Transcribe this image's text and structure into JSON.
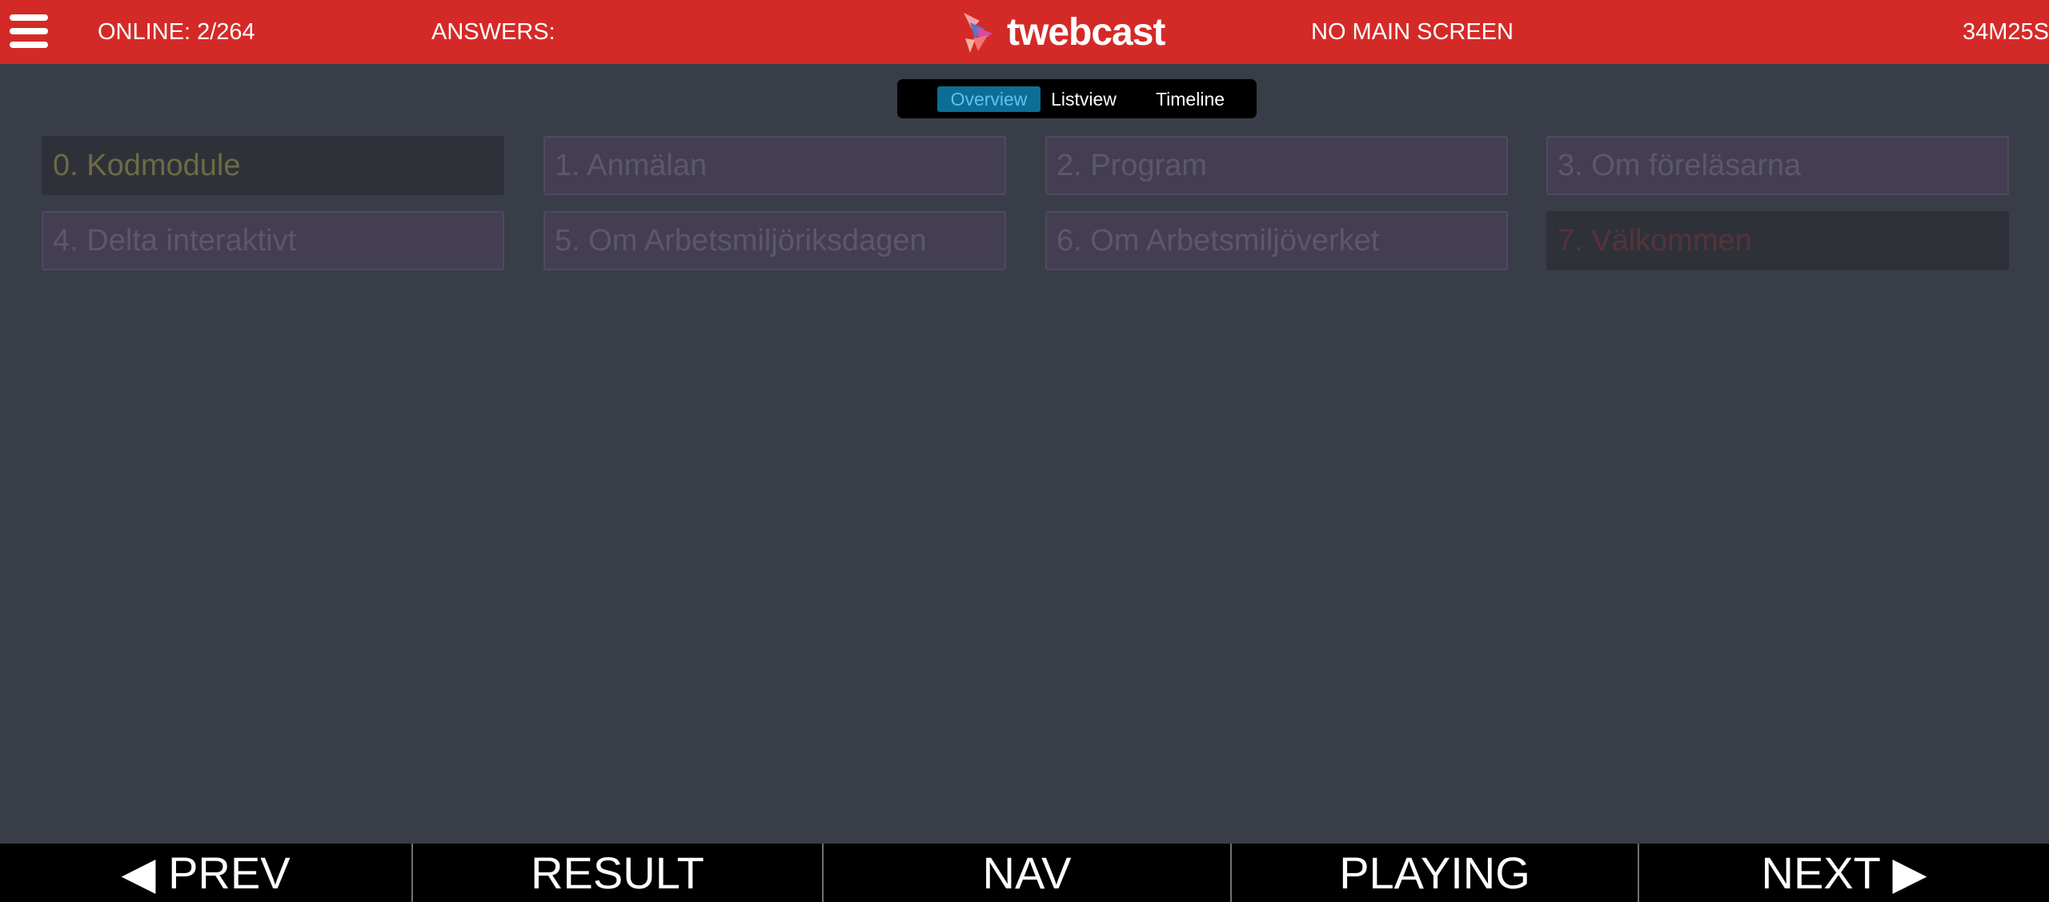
{
  "header": {
    "menu_icon": "hamburger-menu-icon",
    "online": "ONLINE: 2/264",
    "answers": "ANSWERS:",
    "logo_text": "twebcast",
    "main_screen": "NO MAIN SCREEN",
    "timer": "34M25S",
    "colors": {
      "bar": "#d42a27",
      "text": "#ffffff"
    }
  },
  "view_tabs": {
    "overview": "Overview",
    "listview": "Listview",
    "timeline": "Timeline",
    "active": "Overview",
    "colors": {
      "active_bg": "#0d6e95",
      "active_text": "#5cc4ef"
    }
  },
  "modules": [
    {
      "label": "0. Kodmodule",
      "state": "current"
    },
    {
      "label": "1. Anmälan",
      "state": "normal"
    },
    {
      "label": "2. Program",
      "state": "normal"
    },
    {
      "label": "3. Om föreläsarna",
      "state": "normal"
    },
    {
      "label": "4. Delta interaktivt",
      "state": "normal"
    },
    {
      "label": "5. Om Arbetsmiljöriksdagen",
      "state": "normal"
    },
    {
      "label": "6. Om Arbetsmiljöverket",
      "state": "normal"
    },
    {
      "label": "7. Välkommen",
      "state": "inactive"
    }
  ],
  "footer": {
    "prev": "◀ PREV",
    "result": "RESULT",
    "nav": "NAV",
    "playing": "PLAYING",
    "next": "NEXT ▶"
  },
  "colors": {
    "background": "#393d48",
    "module_bg": "#443e52",
    "module_text": "#5c586a",
    "current_text": "#6c6b45",
    "inactive_text": "#56333a",
    "footer_bg": "#000000"
  }
}
